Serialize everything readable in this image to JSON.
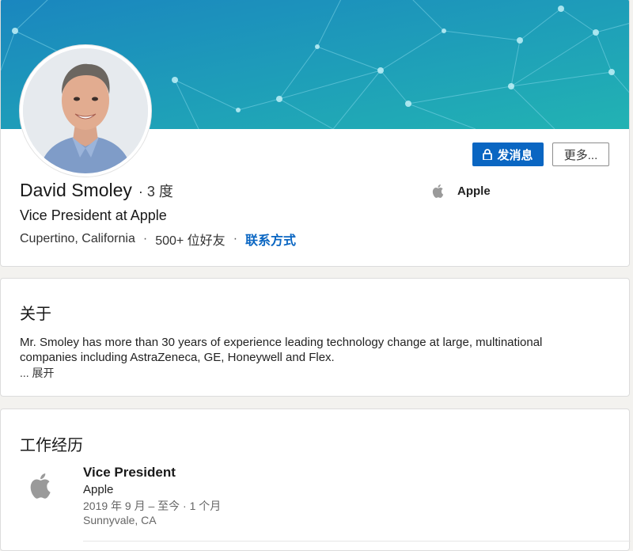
{
  "profile": {
    "name": "David Smoley",
    "degree": "· 3 度",
    "headline": "Vice President at Apple",
    "location": "Cupertino, California",
    "connections": "500+ 位好友",
    "contact_info": "联系方式",
    "separator": "·",
    "current_company": "Apple",
    "message_button": "发消息",
    "more_button": "更多..."
  },
  "about": {
    "title": "关于",
    "text": "Mr. Smoley has more than 30 years of experience leading technology change at large, multinational companies including AstraZeneca, GE, Honeywell and Flex.",
    "expand": "... 展开"
  },
  "experience": {
    "title": "工作经历",
    "items": [
      {
        "role": "Vice President",
        "company": "Apple",
        "dates": "2019 年 9 月 – 至今 · 1 个月",
        "location": "Sunnyvale, CA"
      }
    ]
  },
  "colors": {
    "primary": "#0a66c2",
    "banner_top": "#1d8fbf",
    "banner_bottom": "#21b0b4"
  },
  "icons": {
    "lock": "lock-icon",
    "company_logo": "apple-logo-icon"
  }
}
